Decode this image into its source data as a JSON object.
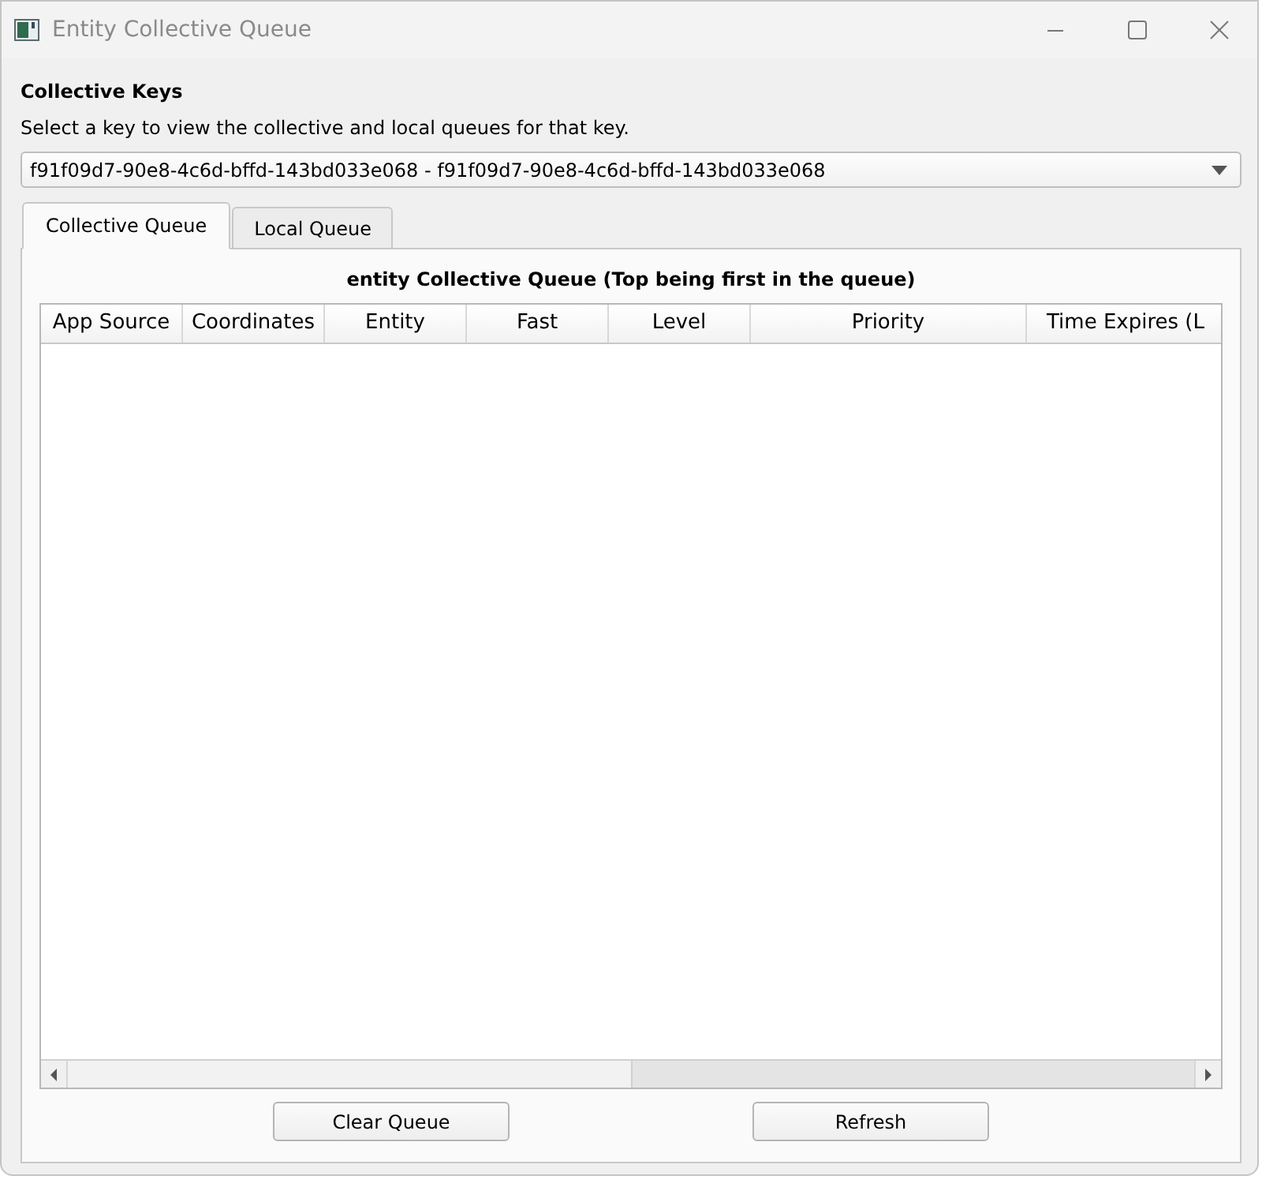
{
  "window": {
    "title": "Entity Collective Queue"
  },
  "keys": {
    "heading": "Collective Keys",
    "description": "Select a key to view the collective and local queues for that key.",
    "selected_key": "f91f09d7-90e8-4c6d-bffd-143bd033e068 - f91f09d7-90e8-4c6d-bffd-143bd033e068"
  },
  "tabs": [
    {
      "label": "Collective Queue",
      "selected": true
    },
    {
      "label": "Local Queue",
      "selected": false
    }
  ],
  "queue": {
    "title": "entity Collective Queue (Top being first in the queue)",
    "columns": [
      "App Source",
      "Coordinates",
      "Entity",
      "Fast",
      "Level",
      "Priority",
      "Time Expires (L"
    ]
  },
  "buttons": [
    "Clear Queue",
    "Refresh"
  ]
}
